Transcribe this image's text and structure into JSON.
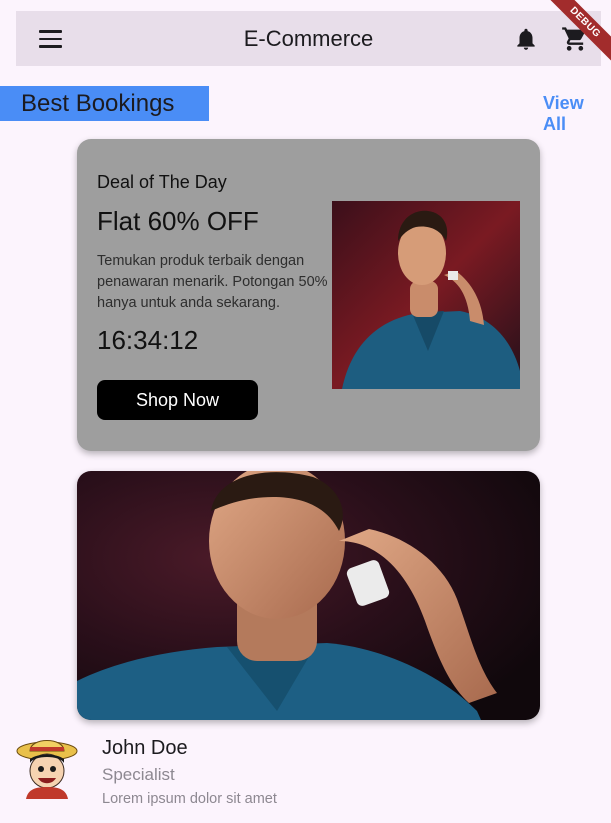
{
  "app_bar": {
    "title": "E-Commerce",
    "icons": [
      "menu-icon",
      "notifications-icon",
      "shopping-cart-icon"
    ],
    "background": "#e8deea"
  },
  "debug_banner": {
    "label": "DEBUG",
    "color": "#a22c2c"
  },
  "section": {
    "title": "Best Bookings",
    "view_all_label": "View All",
    "accent_color": "#4a8df6"
  },
  "deal_card": {
    "subtitle": "Deal of The Day",
    "headline": "Flat 60% OFF",
    "description": "Temukan produk terbaik dengan penawaran menarik. Potongan 50% hanya untuk anda sekarang.",
    "timer": "16:34:12",
    "button_label": "Shop Now",
    "image": "footballer-portrait-photo",
    "background": "#9e9e9e"
  },
  "featured_banner": {
    "image": "footballer-closeup-photo"
  },
  "profile": {
    "name": "John Doe",
    "role": "Specialist",
    "description": "Lorem ipsum dolor sit amet",
    "avatar": "straw-hat-cartoon-avatar"
  }
}
